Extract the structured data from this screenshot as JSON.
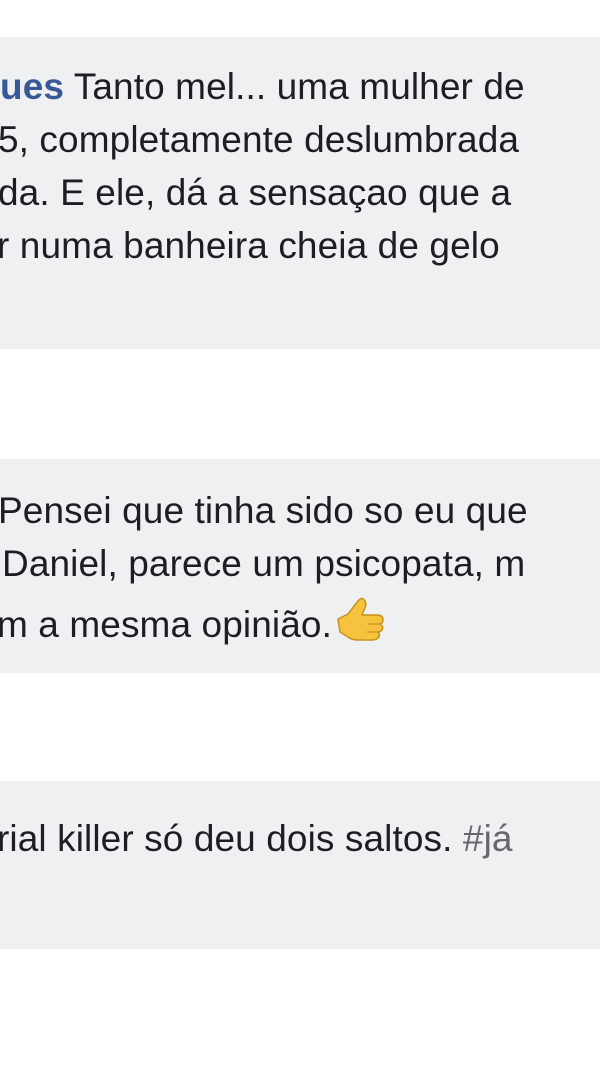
{
  "comments": [
    {
      "author_fragment": "ues",
      "lines": [
        "Tanto mel... uma mulher de",
        "5, completamente deslumbrada",
        "da. E ele, dá a sensaçao que a",
        "r numa banheira cheia de gelo"
      ]
    },
    {
      "lines": [
        "Pensei que tinha sido so eu que",
        "Daniel, parece um psicopata, m",
        "m a mesma opinião."
      ],
      "emoji": "thumbs-up-icon"
    },
    {
      "text": "rial killer só deu dois saltos.",
      "hashtag": "#já"
    }
  ],
  "colors": {
    "bubble_bg": "#eff0f2",
    "author": "#385898",
    "text": "#1c1e21",
    "hashtag": "#65676b",
    "emoji": "#f7c23e"
  }
}
